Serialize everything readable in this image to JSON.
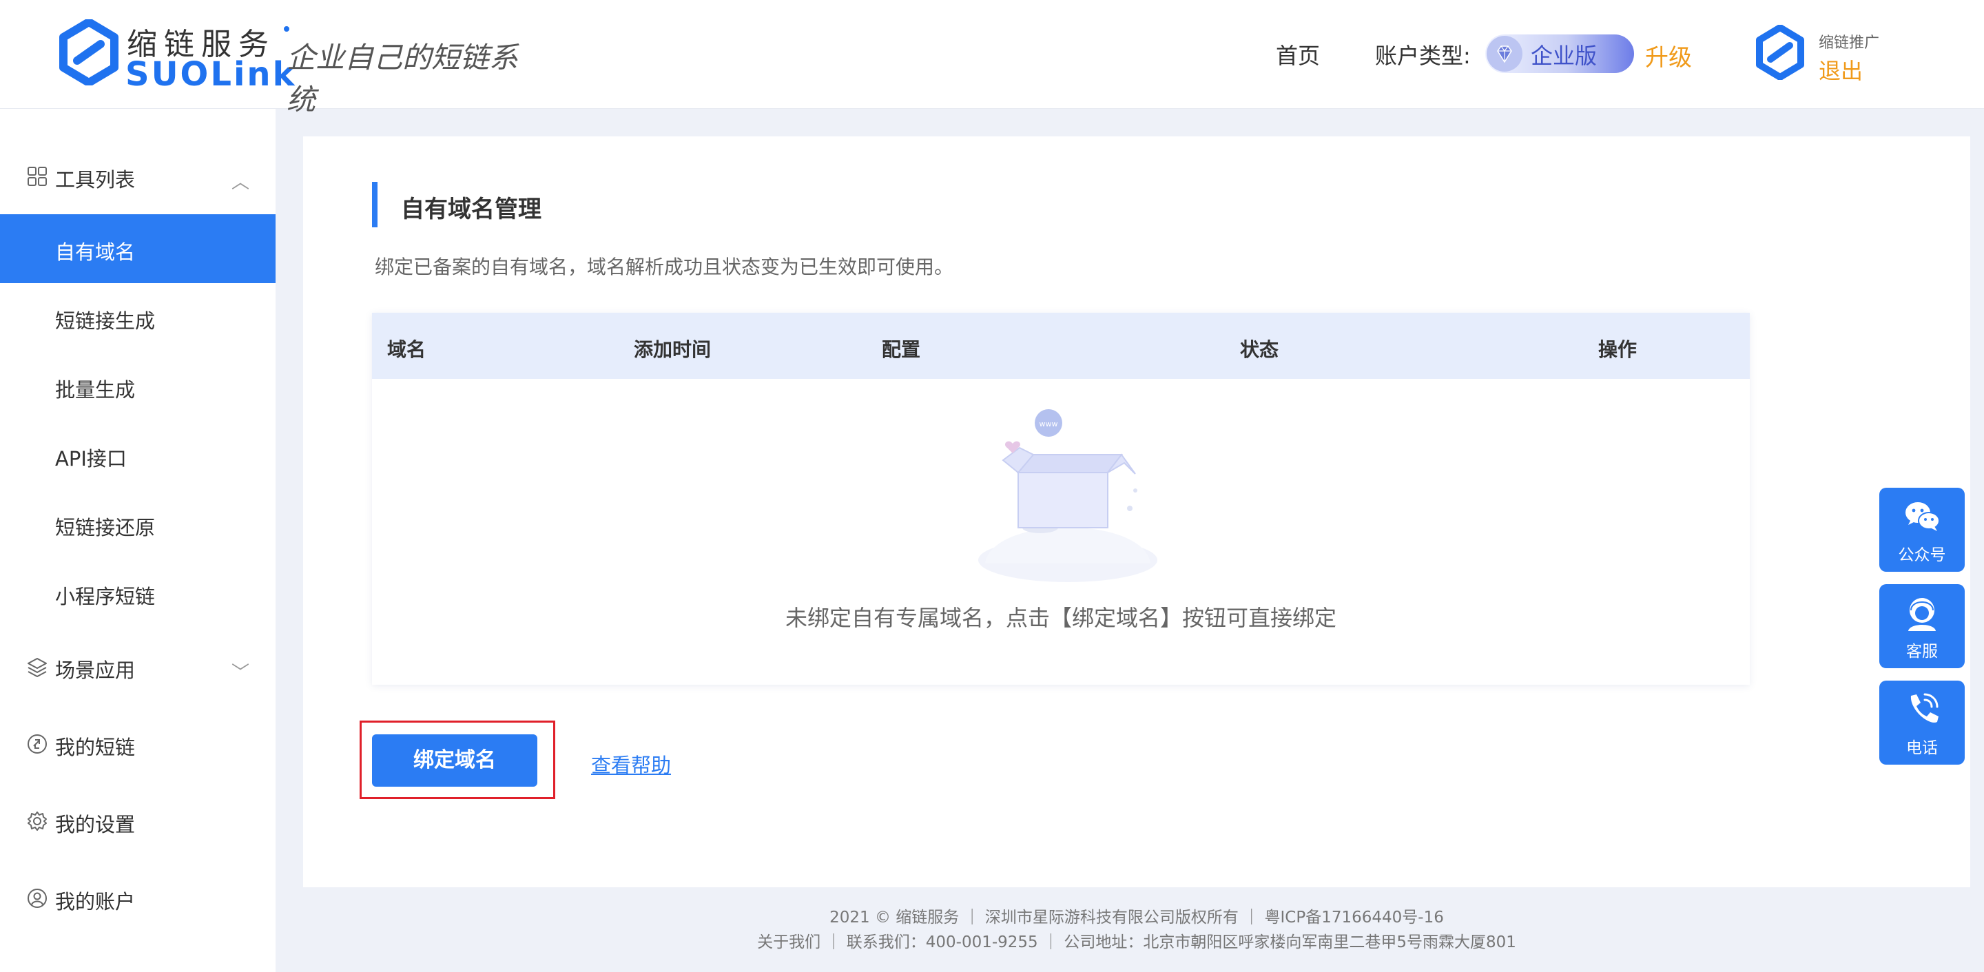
{
  "header": {
    "logo_cn": "缩链服务",
    "logo_en": "SUOLink",
    "slogan": "企业自己的短链系统",
    "nav_home": "首页",
    "account_type_label": "账户类型:",
    "account_type_value": "企业版",
    "upgrade": "升级",
    "promo_label": "缩链推广",
    "logout": "退出"
  },
  "sidebar": {
    "group_tools": "工具列表",
    "items": [
      {
        "label": "自有域名",
        "active": true
      },
      {
        "label": "短链接生成"
      },
      {
        "label": "批量生成"
      },
      {
        "label": "API接口"
      },
      {
        "label": "短链接还原"
      },
      {
        "label": "小程序短链"
      }
    ],
    "group_scenes": "场景应用",
    "my_links": "我的短链",
    "my_settings": "我的设置",
    "my_account": "我的账户"
  },
  "main": {
    "title": "自有域名管理",
    "description": "绑定已备案的自有域名，域名解析成功且状态变为已生效即可使用。",
    "table": {
      "columns": [
        "域名",
        "添加时间",
        "配置",
        "状态",
        "操作"
      ],
      "rows": [],
      "empty_text": "未绑定自有专属域名，点击【绑定域名】按钮可直接绑定"
    },
    "bind_button": "绑定域名",
    "help_link": "查看帮助"
  },
  "footer": {
    "line1": "2021 © 缩链服务 ｜ 深圳市星际游科技有限公司版权所有 ｜  粤ICP备17166440号-16",
    "line2": "关于我们 ｜ 联系我们：400-001-9255 ｜ 公司地址：北京市朝阳区呼家楼向军南里二巷甲5号雨霖大厦801"
  },
  "float_buttons": [
    {
      "label": "公众号",
      "icon": "wechat-icon"
    },
    {
      "label": "客服",
      "icon": "customer-service-icon"
    },
    {
      "label": "电话",
      "icon": "phone-icon"
    }
  ],
  "colors": {
    "accent": "#2b7cf3",
    "upgrade": "#f09a1a",
    "highlight_border": "#e0202a"
  }
}
